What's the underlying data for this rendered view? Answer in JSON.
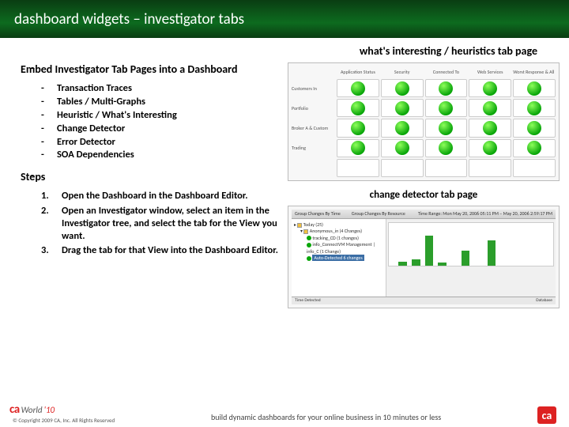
{
  "title": "dashboard widgets – investigator tabs",
  "subhead": "what's interesting / heuristics tab page",
  "section1": {
    "heading": "Embed Investigator Tab Pages into a Dashboard",
    "items": [
      "Transaction Traces",
      "Tables / Multi-Graphs",
      "Heuristic / What's Interesting",
      "Change Detector",
      "Error Detector",
      "SOA Dependencies"
    ]
  },
  "section2": {
    "heading": "Steps",
    "steps": [
      "Open the Dashboard in the Dashboard Editor.",
      "Open an Investigator window, select an item in the Investigator tree, and select the tab for the View you want.",
      "Drag the tab for that View into the Dashboard Editor."
    ]
  },
  "fig1": {
    "cols": [
      "Application Status",
      "Security",
      "Connected To",
      "Web Services",
      "Worst Response & All HTTP Avg"
    ],
    "rows": [
      "Customers In",
      "Portfolio",
      "Broker A & Custom",
      "Trading"
    ]
  },
  "caption2": "change detector tab page",
  "fig2": {
    "tabs": [
      "Group Changes By Time",
      "Group Changes By Resource"
    ],
    "timerange": "Time Range: Mon May 20, 2006 05:11 PM – May 20, 2006 2:59:17 PM",
    "nodes": {
      "a": "Today (25)",
      "b": "Anonymous_in (4 Changes)",
      "c": "tracking_CD (1 changes)",
      "d": "info_ConnectVM Management | info_C (1 Change)",
      "e": "Auto-Detected 6 changes"
    },
    "status_l": "Time Detected",
    "status_r": "Database"
  },
  "footer": {
    "copy": "© Copyright 2009 CA, Inc. All Rights Reserved",
    "text": "build dynamic dashboards for your online business in 10 minutes or less",
    "world": "World",
    "year": "'10",
    "ca": "ca"
  }
}
